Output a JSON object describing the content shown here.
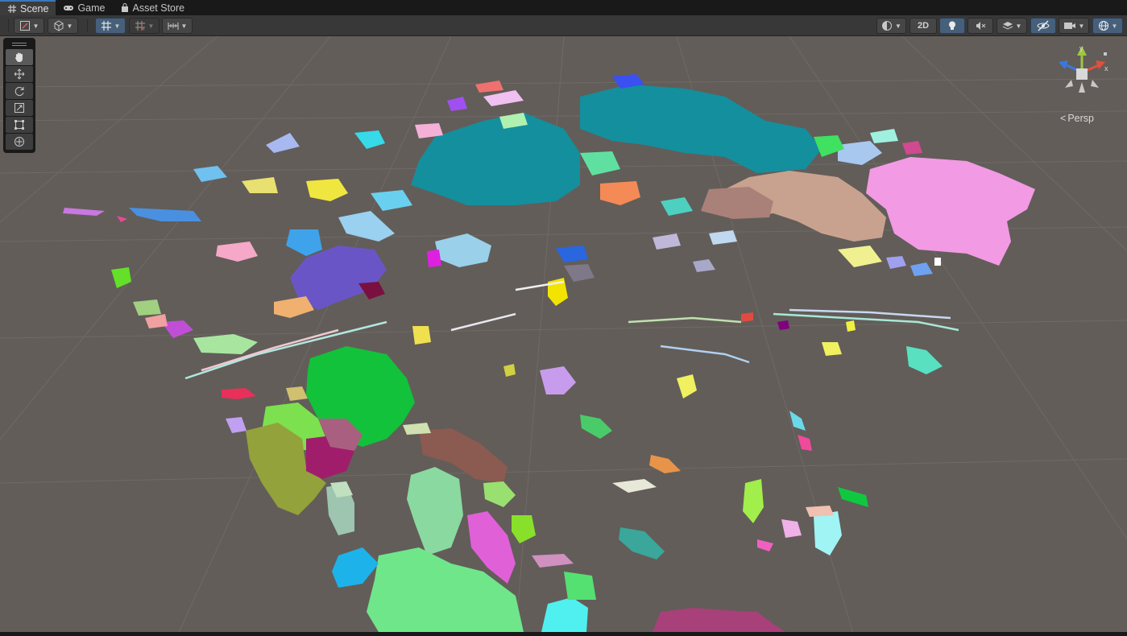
{
  "tabs": [
    {
      "label": "Scene",
      "icon": "grid-icon",
      "active": true
    },
    {
      "label": "Game",
      "icon": "gamepad-icon",
      "active": false
    },
    {
      "label": "Asset Store",
      "icon": "bag-icon",
      "active": false
    }
  ],
  "toolbar": {
    "twod_label": "2D",
    "left_buttons": [
      "draw-mode-dropdown",
      "shading-cube-dropdown",
      "grid-snap-toggle",
      "snap-increment-dropdown",
      "align-tools-dropdown"
    ],
    "right_buttons": [
      "render-mode-dropdown",
      "2d-toggle",
      "lighting-toggle",
      "audio-toggle",
      "effects-dropdown",
      "hidden-objects-toggle",
      "camera-dropdown",
      "gizmos-dropdown"
    ]
  },
  "tools": [
    "hand-tool",
    "move-tool",
    "rotate-tool",
    "scale-tool",
    "rect-tool",
    "transform-tool"
  ],
  "gizmo": {
    "y_label": "y",
    "x_label": "x",
    "projection": "Persp"
  },
  "colors": {
    "viewport": "#625d59",
    "accent": "#3a79bb",
    "teal_region": "#148f9e",
    "pink_region": "#f29ae4",
    "green_region": "#12c23a",
    "tan_region": "#c9a28f"
  }
}
